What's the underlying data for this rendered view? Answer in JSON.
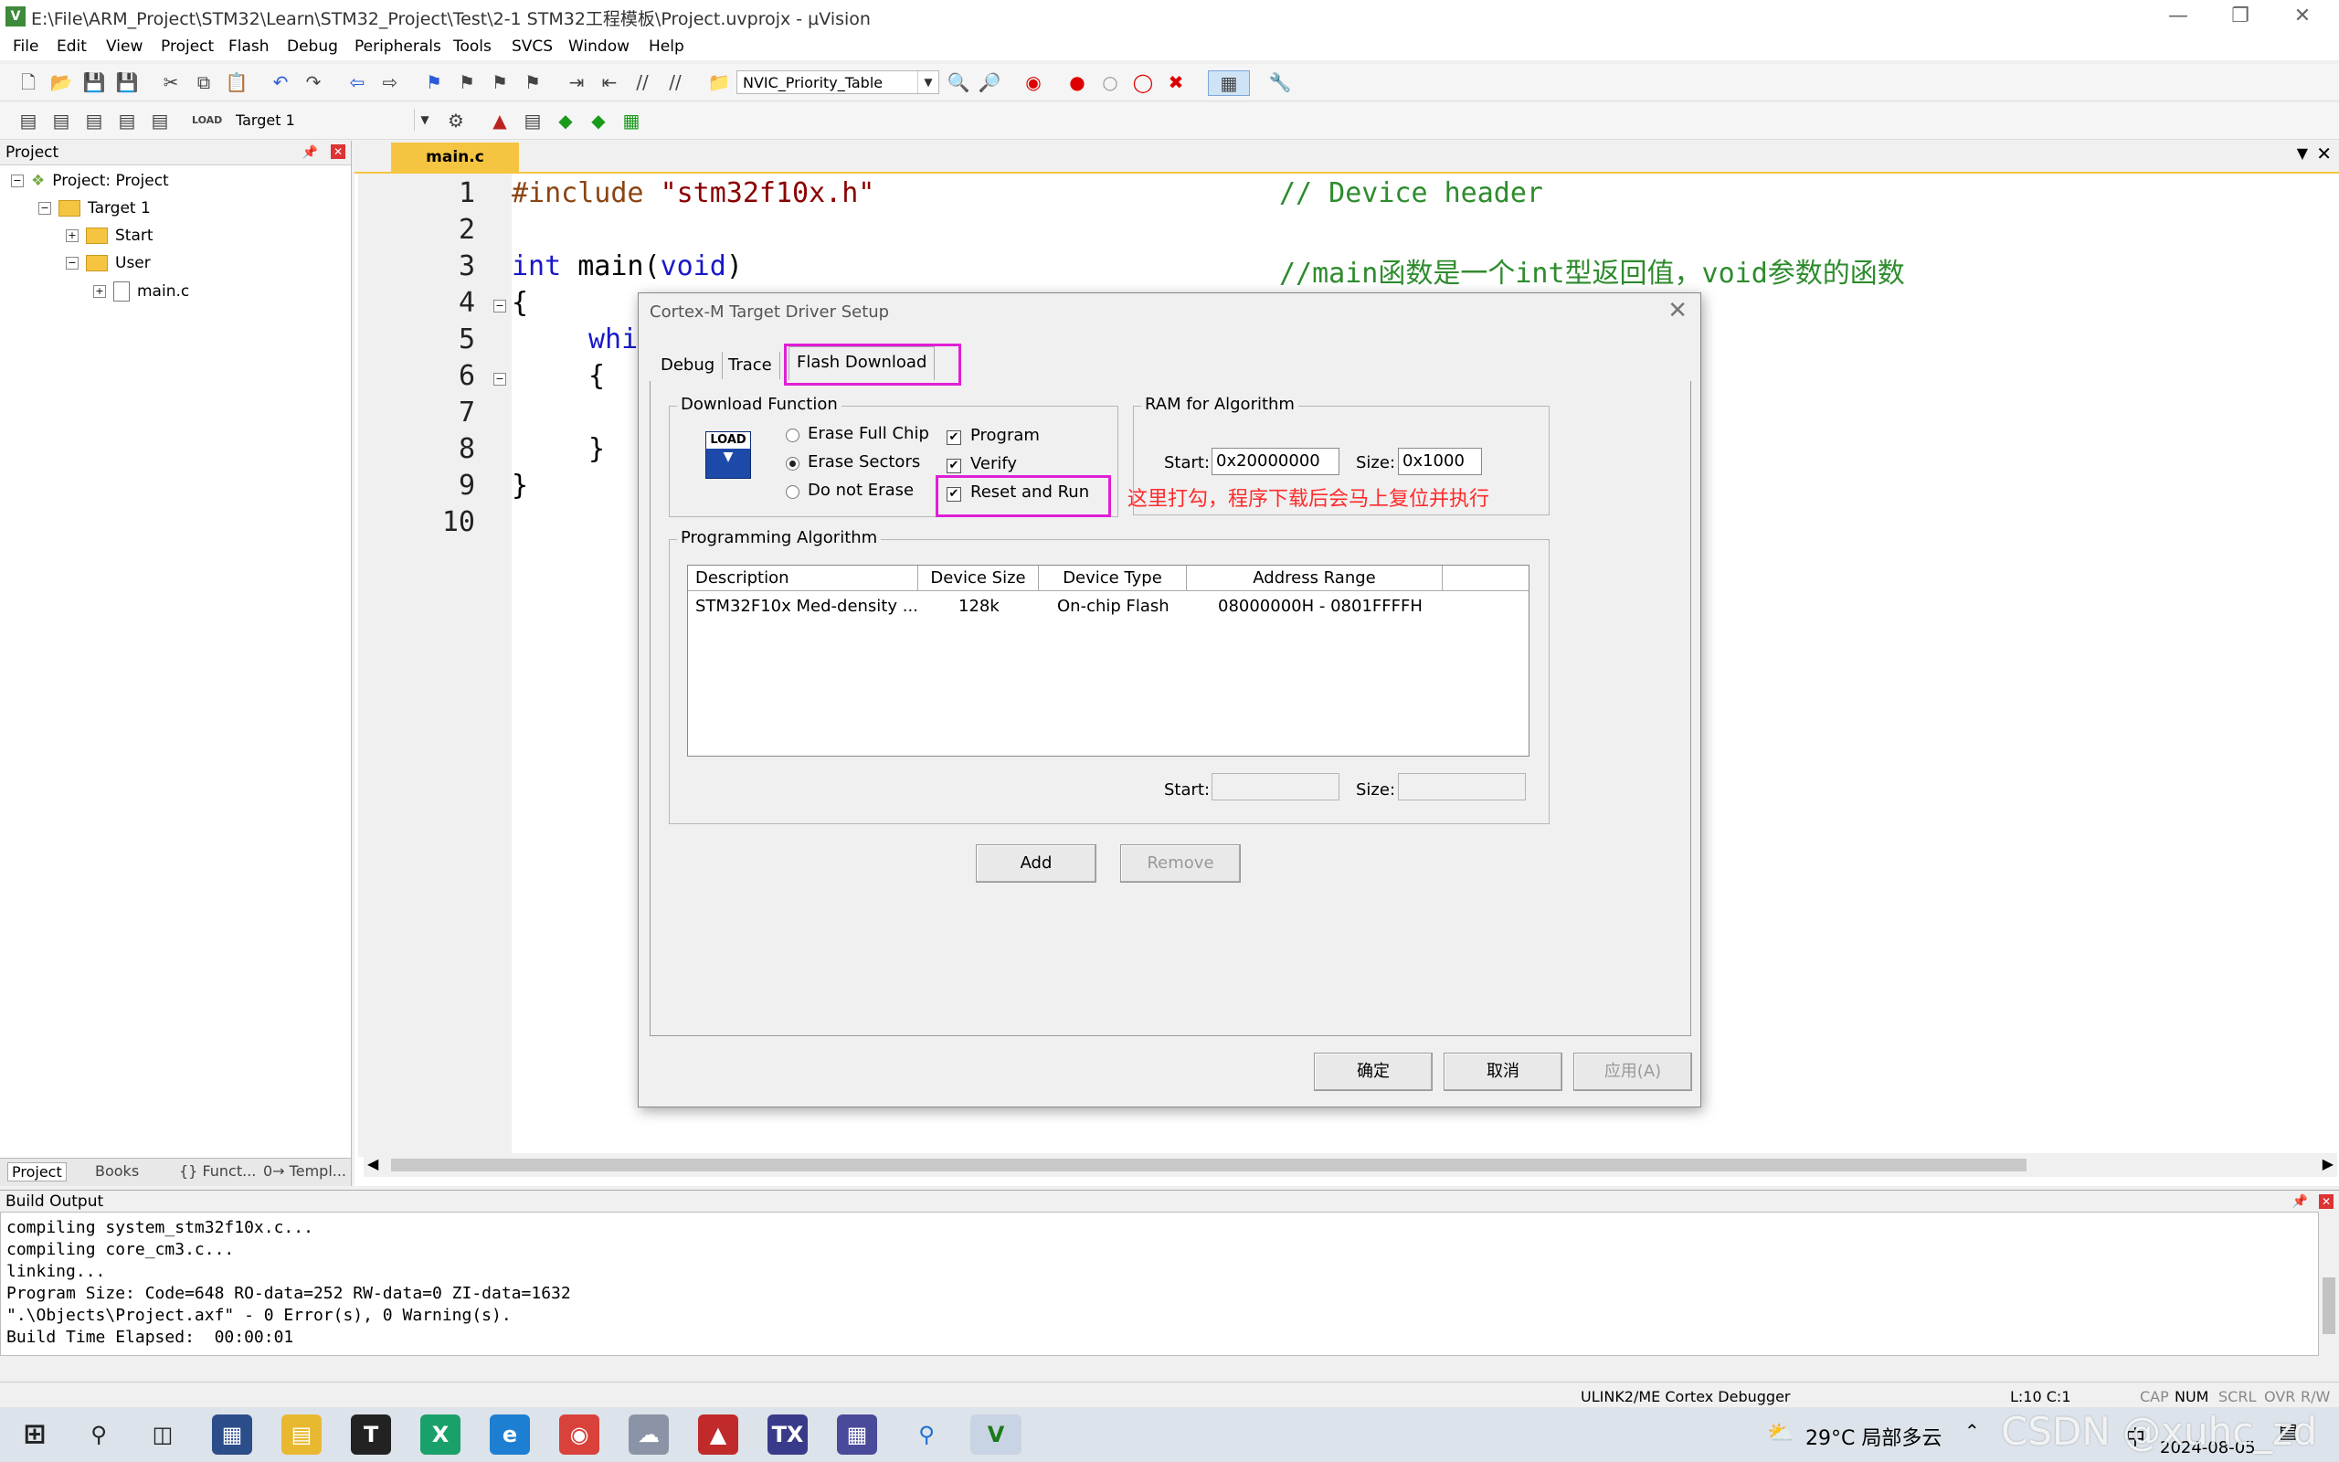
{
  "window": {
    "title": "E:\\File\\ARM_Project\\STM32\\Learn\\STM32_Project\\Test\\2-1 STM32工程模板\\Project.uvprojx - µVision"
  },
  "menu": [
    "File",
    "Edit",
    "View",
    "Project",
    "Flash",
    "Debug",
    "Peripherals",
    "Tools",
    "SVCS",
    "Window",
    "Help"
  ],
  "toolbar": {
    "find_combo": "NVIC_Priority_Table",
    "target_combo": "Target 1"
  },
  "project_pane": {
    "title": "Project",
    "tree": {
      "root": "Project: Project",
      "target": "Target 1",
      "group_start": "Start",
      "group_user": "User",
      "file": "main.c"
    },
    "tabs": [
      "Project",
      "Books",
      "{} Funct...",
      "0→ Templ..."
    ]
  },
  "editor": {
    "tab": "main.c",
    "line_numbers": [
      "1",
      "2",
      "3",
      "4",
      "5",
      "6",
      "7",
      "8",
      "9",
      "10"
    ],
    "line1_directive": "#include",
    "line1_header": "\"stm32f10x.h\"",
    "line1_comment": "// Device header",
    "line3_int": "int",
    "line3_main": " main(",
    "line3_void": "void",
    "line3_close": ")",
    "line3_comment": "//main函数是一个int型返回值，void参数的函数",
    "line4": "{",
    "line5": "whi",
    "line6": "{",
    "line8": "}",
    "line9": "}"
  },
  "build_output": {
    "title": "Build Output",
    "lines": [
      "compiling system_stm32f10x.c...",
      "compiling core_cm3.c...",
      "linking...",
      "Program Size: Code=648 RO-data=252 RW-data=0 ZI-data=1632",
      "\".\\Objects\\Project.axf\" - 0 Error(s), 0 Warning(s).",
      "Build Time Elapsed:  00:00:01"
    ]
  },
  "status_bar": {
    "debugger": "ULINK2/ME Cortex Debugger",
    "position": "L:10 C:1",
    "indicators": [
      "CAP",
      "NUM",
      "SCRL",
      "OVR",
      "R/W"
    ]
  },
  "dialog": {
    "title": "Cortex-M Target Driver Setup",
    "tabs": [
      "Debug",
      "Trace",
      "Flash Download"
    ],
    "download_function": {
      "label": "Download Function",
      "load_icon": "LOAD",
      "erase_full_chip": "Erase Full Chip",
      "erase_sectors": "Erase Sectors",
      "do_not_erase": "Do not Erase",
      "selected_erase": "Erase Sectors",
      "program": "Program",
      "verify": "Verify",
      "reset_and_run": "Reset and Run",
      "program_checked": true,
      "verify_checked": true,
      "reset_and_run_checked": true
    },
    "ram": {
      "label": "RAM for Algorithm",
      "start_label": "Start:",
      "start_value": "0x20000000",
      "size_label": "Size:",
      "size_value": "0x1000"
    },
    "annotation": "这里打勾，程序下载后会马上复位并执行",
    "algorithm": {
      "label": "Programming Algorithm",
      "columns": [
        "Description",
        "Device Size",
        "Device Type",
        "Address Range"
      ],
      "rows": [
        {
          "description": "STM32F10x Med-density ...",
          "size": "128k",
          "type": "On-chip Flash",
          "range": "08000000H - 0801FFFFH"
        }
      ],
      "start_label": "Start:",
      "size_label": "Size:",
      "add": "Add",
      "remove": "Remove"
    },
    "ok": "确定",
    "cancel": "取消",
    "apply": "应用(A)"
  },
  "taskbar": {
    "weather": "29°C 局部多云",
    "ime": "中",
    "date": "2024-08-05",
    "watermark": "CSDN @xuhc_zd"
  }
}
